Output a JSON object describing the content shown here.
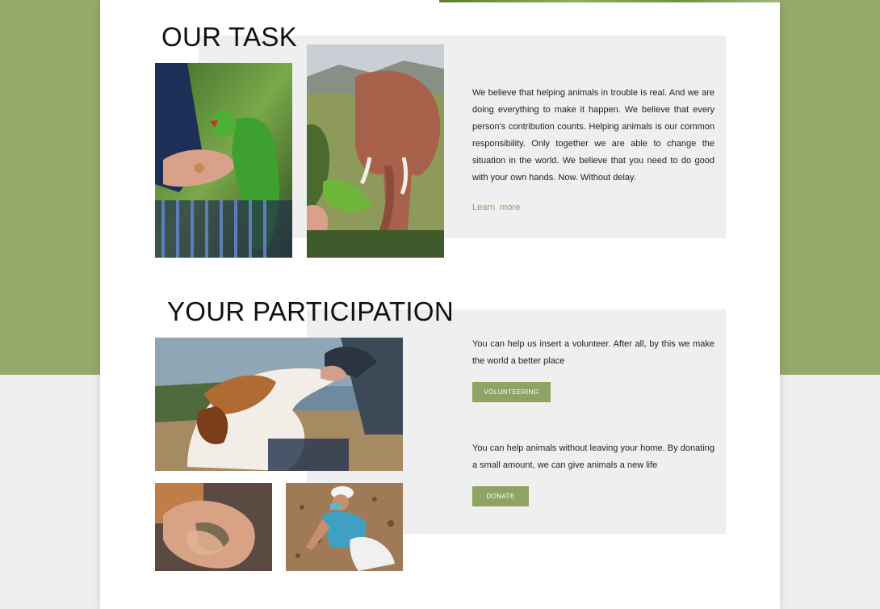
{
  "colors": {
    "accent": "#8fa463",
    "background_top": "#94a86a",
    "background_bottom": "#eeeeee",
    "panel": "#efefef",
    "link": "#8ea25f"
  },
  "task": {
    "heading": "OUR TASK",
    "text": "We believe that helping animals in trouble is real. And we are doing everything to make it happen. We believe that every person's contribution counts. Helping animals is our common responsibility. Only together we are able to change the situation in the world. We believe that you need to do good with your own hands. Now. Without delay.",
    "link_label": "Learn  more"
  },
  "participation": {
    "heading": "YOUR PARTICIPATION",
    "volunteer_text": "You can help us insert a volunteer. After all, by this we make the world a better place",
    "volunteer_button": "VOLUNTEERING",
    "donate_text": "You can help animals without leaving your home. By donating a small amount, we can give animals a new life",
    "donate_button": "DONATE"
  }
}
